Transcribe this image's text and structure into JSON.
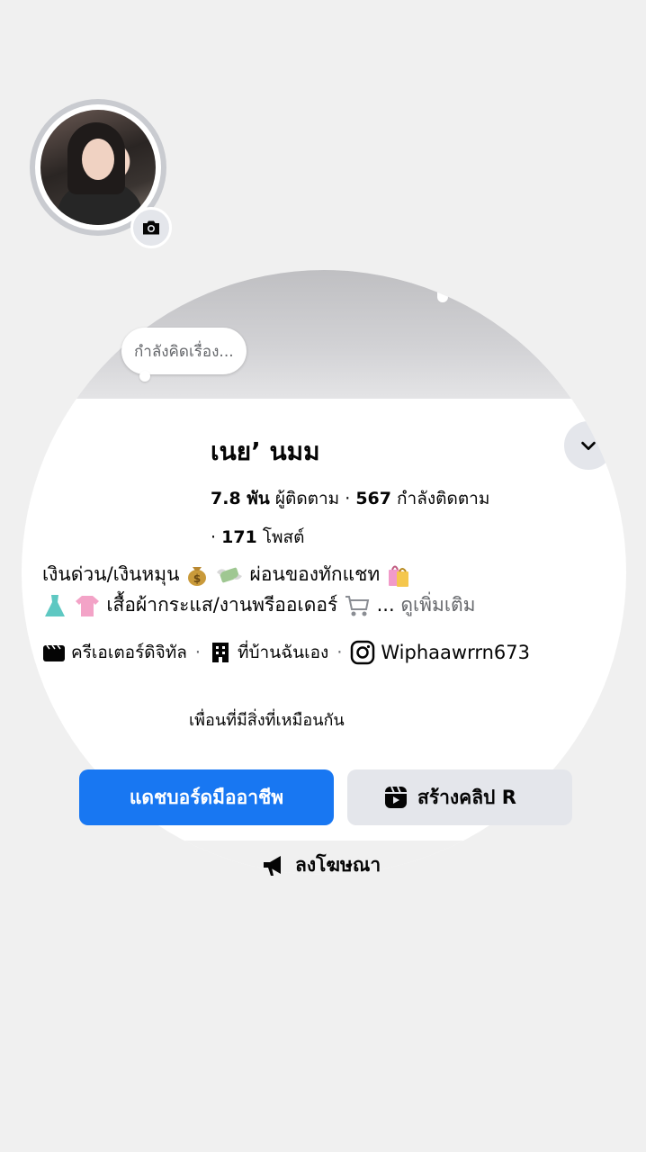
{
  "profile": {
    "thought_bubble": "กำลังคิดเรื่อง...",
    "name": "เนย’ นมม",
    "followers_count": "7.8 พัน",
    "followers_label": "ผู้ติดตาม",
    "following_count": "567",
    "following_label": "กำลังติดตาม",
    "posts_count": "171",
    "posts_label": "โพสต์"
  },
  "bio": {
    "line1_a": "เงินด่วน/เงินหมุน",
    "line1_b": "ผ่อนของทักแชท",
    "line2": "เสื้อผ้ากระแส/งานพรีออเดอร์",
    "ellipsis": "...",
    "see_more": "ดูเพิ่มเติม"
  },
  "meta": {
    "category": "ครีเอเตอร์ดิจิทัล",
    "location": "ที่บ้านฉันเอง",
    "instagram": "Wiphaawrrn673"
  },
  "mutual_text": "เพื่อนที่มีสิ่งที่เหมือนกัน",
  "actions": {
    "dashboard_label": "แดชบอร์ดมืออาชีพ",
    "create_reel_label": "สร้างคลิป R",
    "advertise_label": "ลงโฆษณา"
  },
  "colors": {
    "primary": "#1877f2",
    "secondary_button": "#e4e6eb",
    "page_background": "#f0f0f0",
    "muted_text": "#65676b"
  },
  "icons": {
    "chevron": "chevron-down-icon",
    "camera": "camera-icon",
    "category": "clapperboard-icon",
    "location": "building-icon",
    "instagram": "instagram-icon",
    "reel": "reel-icon",
    "advertise": "megaphone-icon"
  }
}
